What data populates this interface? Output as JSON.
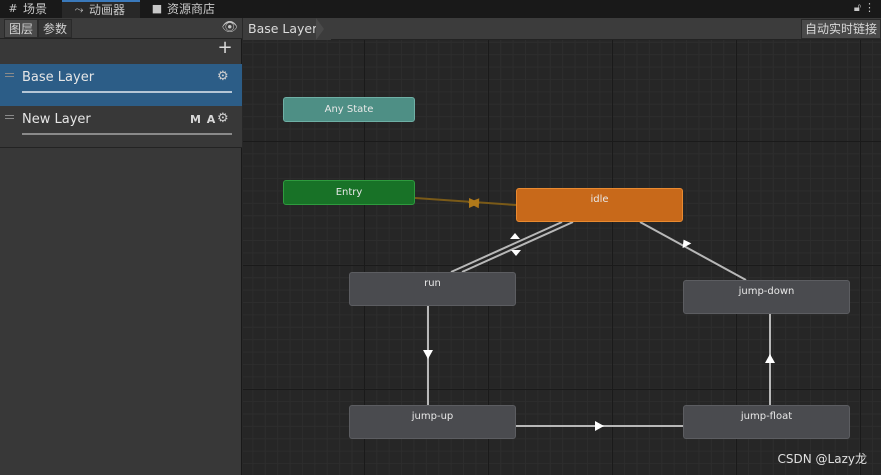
{
  "tabs": [
    {
      "label": "场景",
      "icon": "grid-icon"
    },
    {
      "label": "动画器",
      "icon": "animator-icon"
    },
    {
      "label": "资源商店",
      "icon": "bag-icon"
    }
  ],
  "left_panel": {
    "toolbar": {
      "layers_label": "图层",
      "params_label": "参数"
    },
    "add_label": "+",
    "layers": [
      {
        "name": "Base Layer"
      },
      {
        "name": "New Layer",
        "flags": "M A"
      }
    ]
  },
  "graph": {
    "breadcrumb": "Base Layer",
    "live_link_label": "自动实时链接",
    "states": {
      "any_state": "Any State",
      "entry": "Entry",
      "idle": "idle",
      "run": "run",
      "jump_down": "jump-down",
      "jump_up": "jump-up",
      "jump_float": "jump-float"
    }
  },
  "colors": {
    "selected_layer": "#2c5d87",
    "default_state": "#c8691a",
    "entry_state": "#187227",
    "any_state": "#4e8f85",
    "normal_state": "#4a4b4f"
  },
  "watermark": "CSDN @Lazy龙"
}
